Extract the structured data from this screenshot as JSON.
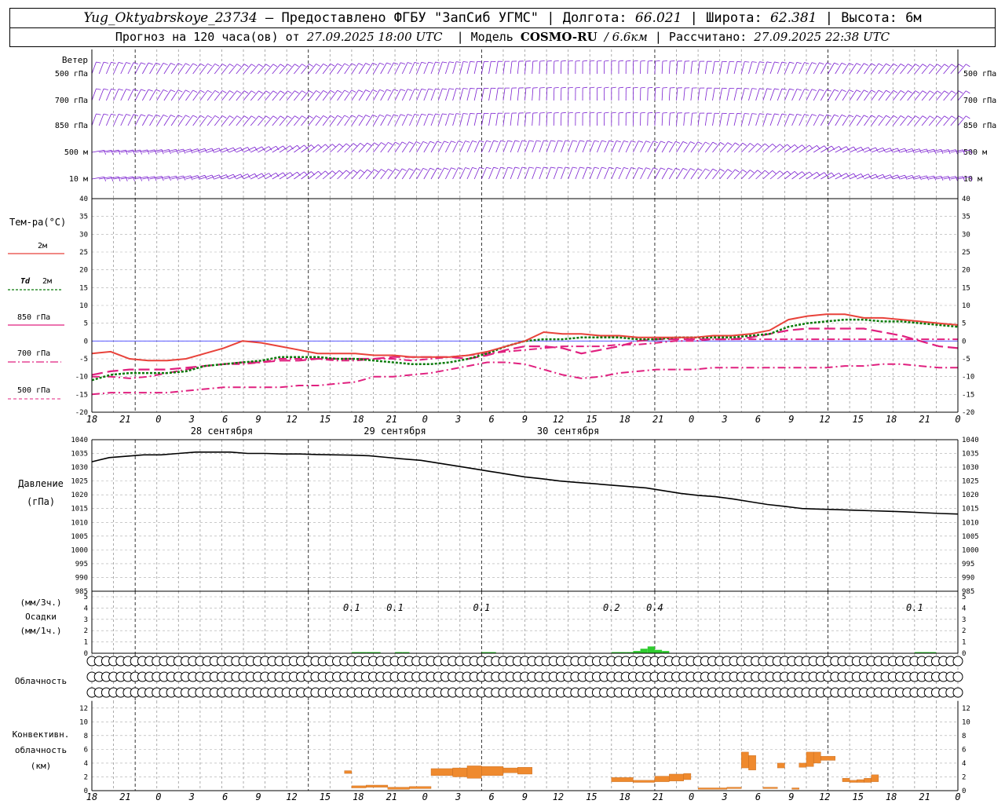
{
  "header": {
    "station": "Yug_Oktyabrskoye_23734",
    "provided": "– Предоставлено ФГБУ \"ЗапСиб УГМС\"",
    "lon_label": "Долгота:",
    "lon": "66.021",
    "lat_label": "Широта:",
    "lat": "62.381",
    "alt_label": "Высота:",
    "alt": "6м",
    "forecast_label": "Прогноз на 120 часа(ов) от",
    "forecast_time": "27.09.2025 18:00 UTC",
    "model_label": "Модель",
    "model": "COSMO-RU",
    "resolution": "/ 6.6км",
    "calc_label": "Рассчитано:",
    "calc_time": "27.09.2025 22:38 UTC"
  },
  "colors": {
    "wind": "#7a1fd0",
    "t2m": "#e8423a",
    "td2m": "#0a7a0a",
    "t850": "#e0207f",
    "t700": "#e0207f",
    "t500": "#e0207f",
    "pressure": "#000000",
    "precip": "#2ecc2e",
    "convective": "#ef8a2e",
    "zero_line": "#4040ff"
  },
  "labels": {
    "wind_title": "Ветер",
    "wind_levels": [
      "500 гПа",
      "700 гПа",
      "850 гПа",
      "500 м",
      "10 м"
    ],
    "temp_title": "Тем-ра(°C)",
    "legend_2m": "2м",
    "legend_td": "Td",
    "legend_td2": "2м",
    "legend_850": "850 гПа",
    "legend_700": "700 гПа",
    "legend_500": "500 гПа",
    "pressure_title": "Давление",
    "pressure_unit": "(гПа)",
    "precip_unit1": "(мм/3ч.)",
    "precip_title": "Осадки",
    "precip_unit2": "(мм/1ч.)",
    "cloud_title": "Облачность",
    "conv_title1": "Конвективн.",
    "conv_title2": "облачность",
    "conv_unit": "(км)"
  },
  "chart_data": {
    "type": "line",
    "x_hours": [
      "18",
      "21",
      "0",
      "3",
      "6",
      "9",
      "12",
      "15",
      "18",
      "21",
      "0",
      "3",
      "6",
      "9",
      "12",
      "15",
      "18",
      "21",
      "0",
      "3",
      "6",
      "9",
      "12",
      "15",
      "18",
      "21",
      "0"
    ],
    "dates": [
      "28 сентября",
      "29 сентября",
      "30 сентября"
    ],
    "temperature": {
      "ylim": [
        -20,
        40
      ],
      "yticks": [
        -20,
        -15,
        -10,
        -5,
        0,
        5,
        10,
        15,
        20,
        25,
        30,
        35,
        40
      ],
      "t2m": [
        -3.5,
        -3.0,
        -5.0,
        -5.5,
        -5.5,
        -5.0,
        -3.5,
        -2.0,
        0,
        -0.5,
        -1.5,
        -2.5,
        -3.5,
        -3.5,
        -3.5,
        -4.0,
        -4.0,
        -4.5,
        -4.5,
        -4.5,
        -4.0,
        -3.0,
        -1.5,
        0,
        2.5,
        2.0,
        2.0,
        1.5,
        1.5,
        1.0,
        1.0,
        1.0,
        1.0,
        1.5,
        1.5,
        2.0,
        3.0,
        6.0,
        7.0,
        7.5,
        7.5,
        6.5,
        6.5,
        6.0,
        5.5,
        5.0,
        4.5
      ],
      "td2m": [
        -11.0,
        -9.5,
        -9.0,
        -9.0,
        -9.0,
        -8.5,
        -7.0,
        -6.5,
        -6.0,
        -5.5,
        -4.5,
        -4.5,
        -4.5,
        -5.0,
        -5.0,
        -5.5,
        -6.0,
        -6.5,
        -6.5,
        -6.0,
        -5.0,
        -3.5,
        -1.5,
        0,
        0.5,
        0.5,
        1.0,
        1.0,
        1.0,
        0.5,
        0.5,
        1.0,
        1.0,
        1.0,
        1.0,
        1.5,
        2.0,
        4.0,
        5.0,
        5.5,
        6.0,
        6.0,
        5.5,
        5.5,
        5.0,
        4.5,
        4.0
      ],
      "t850": [
        -9.5,
        -8.5,
        -8.0,
        -8.0,
        -8.0,
        -7.5,
        -7.0,
        -6.5,
        -6.0,
        -6.0,
        -5.5,
        -5.5,
        -5.0,
        -5.0,
        -5.0,
        -5.0,
        -4.5,
        -4.5,
        -4.5,
        -4.5,
        -5.0,
        -4.0,
        -2.5,
        -1.5,
        -1.5,
        -2.0,
        -3.5,
        -2.5,
        -1.5,
        0,
        0.5,
        0.5,
        0.5,
        0.5,
        0.5,
        1.0,
        2.0,
        3.0,
        3.5,
        3.5,
        3.5,
        3.5,
        2.5,
        1.5,
        0,
        -1.5,
        -2.0
      ],
      "t700": [
        -10.0,
        -10.0,
        -10.5,
        -10.0,
        -9.0,
        -8.0,
        -7.0,
        -6.5,
        -6.5,
        -6.0,
        -5.0,
        -5.0,
        -5.0,
        -5.5,
        -5.5,
        -5.0,
        -5.0,
        -5.5,
        -5.0,
        -4.5,
        -4.0,
        -3.5,
        -3.0,
        -2.5,
        -2.0,
        -1.5,
        -1.5,
        -1.5,
        -1.0,
        -1.0,
        -0.5,
        0,
        0,
        0.5,
        0.5,
        0.5,
        0.5,
        0.5,
        0.5,
        0.5,
        0.5,
        0.5,
        0.5,
        0.5,
        0.5,
        0.5,
        0.5
      ],
      "t500": [
        -15.0,
        -14.5,
        -14.5,
        -14.5,
        -14.5,
        -14.0,
        -13.5,
        -13.0,
        -13.0,
        -13.0,
        -13.0,
        -12.5,
        -12.5,
        -12.0,
        -11.5,
        -10.0,
        -10.0,
        -9.5,
        -9.0,
        -8.0,
        -7.0,
        -6.0,
        -6.0,
        -6.5,
        -8.0,
        -9.5,
        -10.5,
        -10.0,
        -9.0,
        -8.5,
        -8.0,
        -8.0,
        -8.0,
        -7.5,
        -7.5,
        -7.5,
        -7.5,
        -7.5,
        -7.5,
        -7.5,
        -7.0,
        -7.0,
        -6.5,
        -6.5,
        -7.0,
        -7.5,
        -7.5
      ]
    },
    "pressure": {
      "ylim": [
        985,
        1040
      ],
      "yticks": [
        985,
        990,
        995,
        1000,
        1005,
        1010,
        1015,
        1020,
        1025,
        1030,
        1035,
        1040
      ],
      "values": [
        1032.0,
        1033.5,
        1034.0,
        1034.5,
        1034.5,
        1035.0,
        1035.5,
        1035.5,
        1035.5,
        1035.0,
        1035.0,
        1034.8,
        1034.8,
        1034.6,
        1034.5,
        1034.4,
        1034.2,
        1033.6,
        1033.0,
        1032.5,
        1031.5,
        1030.5,
        1029.5,
        1028.5,
        1027.5,
        1026.5,
        1025.8,
        1025.0,
        1024.5,
        1024.0,
        1023.5,
        1023.0,
        1022.5,
        1021.5,
        1020.5,
        1019.8,
        1019.3,
        1018.5,
        1017.5,
        1016.5,
        1015.8,
        1015.0,
        1014.8,
        1014.6,
        1014.4,
        1014.2,
        1014.0,
        1013.8,
        1013.5,
        1013.2,
        1013.0
      ],
      "x_span_hours": 120
    },
    "precip": {
      "ylim": [
        0,
        5
      ],
      "yticks": [
        0,
        1,
        2,
        3,
        4,
        5
      ],
      "labels": [
        {
          "hour": 36,
          "text": "0.1"
        },
        {
          "hour": 42,
          "text": "0.1"
        },
        {
          "hour": 54,
          "text": "0.1"
        },
        {
          "hour": 72,
          "text": "0.2"
        },
        {
          "hour": 78,
          "text": "0.4"
        },
        {
          "hour": 114,
          "text": "0.1"
        }
      ],
      "bars": [
        {
          "hour": 36,
          "v": 0.1
        },
        {
          "hour": 37,
          "v": 0.1
        },
        {
          "hour": 38,
          "v": 0.1
        },
        {
          "hour": 39,
          "v": 0.1
        },
        {
          "hour": 42,
          "v": 0.1
        },
        {
          "hour": 43,
          "v": 0.1
        },
        {
          "hour": 54,
          "v": 0.1
        },
        {
          "hour": 55,
          "v": 0.1
        },
        {
          "hour": 72,
          "v": 0.1
        },
        {
          "hour": 73,
          "v": 0.1
        },
        {
          "hour": 74,
          "v": 0.1
        },
        {
          "hour": 75,
          "v": 0.2
        },
        {
          "hour": 76,
          "v": 0.4
        },
        {
          "hour": 77,
          "v": 0.6
        },
        {
          "hour": 78,
          "v": 0.3
        },
        {
          "hour": 79,
          "v": 0.2
        },
        {
          "hour": 114,
          "v": 0.1
        },
        {
          "hour": 115,
          "v": 0.1
        },
        {
          "hour": 116,
          "v": 0.1
        }
      ]
    },
    "cloudiness": {
      "rows": [
        [
          0,
          0,
          0,
          0,
          0,
          0,
          0,
          0,
          0,
          0,
          0,
          0,
          0,
          0,
          0,
          0,
          0,
          0,
          0,
          0,
          0,
          0,
          0,
          0,
          0,
          0,
          0,
          0,
          0,
          0,
          0,
          0,
          0,
          0,
          0,
          0,
          0,
          0,
          0,
          0,
          0,
          0,
          0,
          0,
          0,
          0,
          0,
          0,
          0,
          0,
          0,
          0,
          0,
          0,
          0,
          0,
          0,
          0,
          0,
          0,
          0,
          0,
          0,
          0,
          0,
          0,
          0,
          0,
          0,
          0,
          0,
          0,
          0,
          0,
          0,
          0,
          0,
          0,
          0,
          0,
          0,
          0,
          0,
          0,
          0,
          0,
          0,
          0,
          0,
          0,
          0,
          0,
          0,
          0,
          0,
          0,
          0,
          0,
          0,
          0,
          0,
          0,
          0,
          0,
          0,
          0,
          0,
          0,
          0,
          0,
          0,
          0,
          0,
          0,
          0,
          0,
          0,
          0,
          0,
          0,
          0
        ],
        [
          0,
          0,
          0,
          0,
          0,
          0,
          0,
          0,
          0,
          0,
          0,
          0,
          0,
          0,
          0,
          0,
          0,
          0,
          0,
          0,
          0,
          0,
          0,
          0,
          0,
          0,
          0,
          0,
          0,
          0,
          0,
          0,
          0,
          0,
          0,
          0,
          0,
          0,
          0,
          0,
          0,
          0,
          0,
          0,
          0,
          0,
          0,
          0,
          0,
          0,
          0,
          0,
          0,
          0,
          0,
          0,
          0,
          0,
          0,
          0,
          0,
          0,
          0,
          0,
          0,
          0,
          0,
          0,
          0,
          0,
          0,
          0,
          0,
          0,
          0,
          0,
          0,
          0,
          0,
          0,
          0,
          0,
          0,
          0,
          0,
          0,
          0,
          0,
          0,
          0,
          0,
          0,
          0,
          0,
          0,
          0,
          0,
          0,
          0,
          0,
          0,
          0,
          0,
          0,
          0,
          0,
          0,
          0,
          0,
          0,
          0,
          0,
          0,
          0,
          0,
          0,
          0,
          0,
          0,
          0,
          0
        ],
        [
          0,
          0,
          0,
          0,
          0,
          0,
          0,
          0,
          0,
          0,
          0,
          0,
          0,
          0,
          0,
          0,
          0,
          0,
          0,
          0,
          0,
          0,
          0,
          0,
          0,
          0,
          0,
          0,
          0,
          0,
          0,
          0,
          0,
          0,
          0,
          0,
          0,
          0,
          0,
          0,
          0,
          0,
          0,
          0,
          0,
          0,
          0,
          0,
          0,
          0,
          0,
          0,
          0,
          0,
          0,
          0,
          0,
          0,
          0,
          0,
          0,
          0,
          0,
          0,
          0,
          0,
          0,
          0,
          0,
          0,
          0,
          0,
          0,
          0,
          0,
          0,
          0,
          0,
          0,
          0,
          0,
          0,
          0,
          0,
          0,
          0,
          0,
          0,
          0,
          0,
          0,
          0,
          0,
          0,
          0,
          0,
          0,
          0,
          0,
          0,
          0,
          0,
          0,
          0,
          0,
          0,
          0,
          0,
          0,
          0,
          0,
          0,
          0,
          0,
          0,
          0,
          0,
          0,
          0,
          0,
          0
        ]
      ]
    },
    "convective": {
      "ylim": [
        0,
        13
      ],
      "yticks": [
        0,
        2,
        4,
        6,
        8,
        10,
        12
      ],
      "blocks": [
        {
          "h0": 35,
          "h1": 36,
          "b": 2.5,
          "t": 2.9
        },
        {
          "h0": 36,
          "h1": 38,
          "b": 0.4,
          "t": 0.7
        },
        {
          "h0": 38,
          "h1": 41,
          "b": 0.5,
          "t": 0.8
        },
        {
          "h0": 41,
          "h1": 44,
          "b": 0.2,
          "t": 0.5
        },
        {
          "h0": 44,
          "h1": 47,
          "b": 0.3,
          "t": 0.6
        },
        {
          "h0": 47,
          "h1": 50,
          "b": 2.2,
          "t": 3.2
        },
        {
          "h0": 50,
          "h1": 52,
          "b": 2.0,
          "t": 3.3
        },
        {
          "h0": 52,
          "h1": 54,
          "b": 1.8,
          "t": 3.6
        },
        {
          "h0": 54,
          "h1": 57,
          "b": 2.2,
          "t": 3.5
        },
        {
          "h0": 57,
          "h1": 59,
          "b": 2.6,
          "t": 3.3
        },
        {
          "h0": 59,
          "h1": 61,
          "b": 2.4,
          "t": 3.4
        },
        {
          "h0": 72,
          "h1": 75,
          "b": 1.3,
          "t": 1.9
        },
        {
          "h0": 75,
          "h1": 78,
          "b": 1.2,
          "t": 1.5
        },
        {
          "h0": 78,
          "h1": 80,
          "b": 1.3,
          "t": 2.1
        },
        {
          "h0": 80,
          "h1": 82,
          "b": 1.4,
          "t": 2.4
        },
        {
          "h0": 82,
          "h1": 83,
          "b": 1.6,
          "t": 2.5
        },
        {
          "h0": 84,
          "h1": 88,
          "b": 0.2,
          "t": 0.4
        },
        {
          "h0": 88,
          "h1": 90,
          "b": 0.3,
          "t": 0.5
        },
        {
          "h0": 90,
          "h1": 91,
          "b": 3.3,
          "t": 5.6
        },
        {
          "h0": 91,
          "h1": 92,
          "b": 3.0,
          "t": 5.1
        },
        {
          "h0": 93,
          "h1": 95,
          "b": 0.3,
          "t": 0.5
        },
        {
          "h0": 95,
          "h1": 96,
          "b": 3.3,
          "t": 4.0
        },
        {
          "h0": 97,
          "h1": 98,
          "b": 0.2,
          "t": 0.4
        },
        {
          "h0": 98,
          "h1": 99,
          "b": 3.4,
          "t": 4.0
        },
        {
          "h0": 99,
          "h1": 100,
          "b": 3.5,
          "t": 5.6
        },
        {
          "h0": 100,
          "h1": 101,
          "b": 4.0,
          "t": 5.6
        },
        {
          "h0": 101,
          "h1": 103,
          "b": 4.4,
          "t": 5.0
        },
        {
          "h0": 104,
          "h1": 105,
          "b": 1.3,
          "t": 1.8
        },
        {
          "h0": 105,
          "h1": 106,
          "b": 1.2,
          "t": 1.5
        },
        {
          "h0": 106,
          "h1": 107,
          "b": 1.2,
          "t": 1.6
        },
        {
          "h0": 107,
          "h1": 108,
          "b": 1.2,
          "t": 1.8
        },
        {
          "h0": 108,
          "h1": 109,
          "b": 1.3,
          "t": 2.3
        }
      ]
    }
  }
}
